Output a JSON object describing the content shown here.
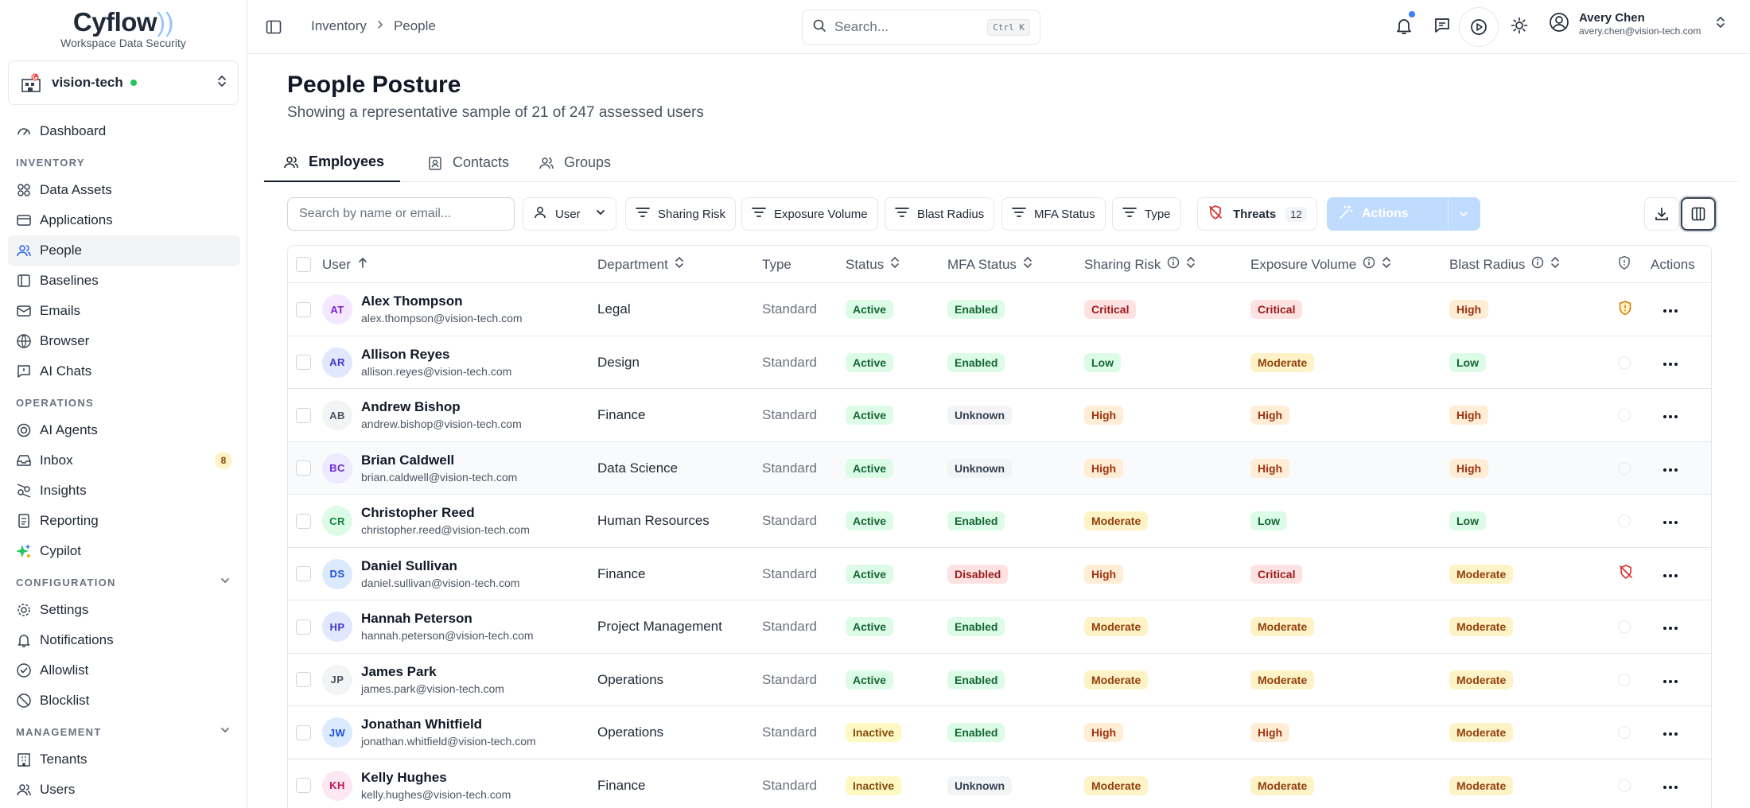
{
  "brand": {
    "name": "Cyflow",
    "tagline": "Workspace Data Security"
  },
  "tenant": {
    "name": "vision-tech",
    "status_color": "#22c55e"
  },
  "sidebar": {
    "top": [
      {
        "label": "Dashboard",
        "icon": "dashboard-icon"
      }
    ],
    "inventory_heading": "INVENTORY",
    "inventory": [
      {
        "label": "Data Assets",
        "icon": "data-assets-icon"
      },
      {
        "label": "Applications",
        "icon": "applications-icon"
      },
      {
        "label": "People",
        "icon": "people-icon",
        "active": true
      },
      {
        "label": "Baselines",
        "icon": "baselines-icon"
      },
      {
        "label": "Emails",
        "icon": "mail-icon"
      },
      {
        "label": "Browser",
        "icon": "globe-icon"
      },
      {
        "label": "AI Chats",
        "icon": "chat-icon"
      }
    ],
    "operations_heading": "OPERATIONS",
    "operations": [
      {
        "label": "AI Agents",
        "icon": "agents-icon"
      },
      {
        "label": "Inbox",
        "icon": "inbox-icon",
        "badge": "8"
      },
      {
        "label": "Insights",
        "icon": "insights-icon"
      },
      {
        "label": "Reporting",
        "icon": "reporting-icon"
      },
      {
        "label": "Cypilot",
        "icon": "sparkle-icon"
      }
    ],
    "configuration_heading": "CONFIGURATION",
    "configuration": [
      {
        "label": "Settings",
        "icon": "gear-icon"
      },
      {
        "label": "Notifications",
        "icon": "bell-icon"
      },
      {
        "label": "Allowlist",
        "icon": "check-circle-icon"
      },
      {
        "label": "Blocklist",
        "icon": "ban-icon"
      }
    ],
    "management_heading": "MANAGEMENT",
    "management": [
      {
        "label": "Tenants",
        "icon": "tenants-icon"
      },
      {
        "label": "Users",
        "icon": "users-icon"
      }
    ]
  },
  "topbar": {
    "breadcrumb": [
      "Inventory",
      "People"
    ],
    "search_placeholder": "Search...",
    "search_shortcut": "Ctrl K",
    "user_name": "Avery Chen",
    "user_email": "avery.chen@vision-tech.com",
    "accent": "#3b82f6"
  },
  "page": {
    "title": "People Posture",
    "subtitle": "Showing a representative sample of 21 of 247 assessed users"
  },
  "tabs": [
    {
      "label": "Employees",
      "active": true
    },
    {
      "label": "Contacts"
    },
    {
      "label": "Groups"
    }
  ],
  "toolbar": {
    "search_placeholder": "Search by name or email...",
    "user_filter": "User",
    "filters": [
      "Sharing Risk",
      "Exposure Volume",
      "Blast Radius",
      "MFA Status",
      "Type"
    ],
    "threats_label": "Threats",
    "threats_count": "12",
    "actions_label": "Actions"
  },
  "table": {
    "columns": [
      "User",
      "Department",
      "Type",
      "Status",
      "MFA Status",
      "Sharing Risk",
      "Exposure Volume",
      "Blast Radius",
      "Actions"
    ],
    "rows": [
      {
        "initials": "AT",
        "name": "Alex Thompson",
        "email": "alex.thompson@vision-tech.com",
        "department": "Legal",
        "type": "Standard",
        "status": "Active",
        "mfa": "Enabled",
        "sharing": "Critical",
        "exposure": "Critical",
        "blast": "High",
        "threat": "shield-warning"
      },
      {
        "initials": "AR",
        "name": "Allison Reyes",
        "email": "allison.reyes@vision-tech.com",
        "department": "Design",
        "type": "Standard",
        "status": "Active",
        "mfa": "Enabled",
        "sharing": "Low",
        "exposure": "Moderate",
        "blast": "Low",
        "threat": "none"
      },
      {
        "initials": "AB",
        "name": "Andrew Bishop",
        "email": "andrew.bishop@vision-tech.com",
        "department": "Finance",
        "type": "Standard",
        "status": "Active",
        "mfa": "Unknown",
        "sharing": "High",
        "exposure": "High",
        "blast": "High",
        "threat": "none"
      },
      {
        "initials": "BC",
        "name": "Brian Caldwell",
        "email": "brian.caldwell@vision-tech.com",
        "department": "Data Science",
        "type": "Standard",
        "status": "Active",
        "mfa": "Unknown",
        "sharing": "High",
        "exposure": "High",
        "blast": "High",
        "threat": "none",
        "highlight": true
      },
      {
        "initials": "CR",
        "name": "Christopher Reed",
        "email": "christopher.reed@vision-tech.com",
        "department": "Human Resources",
        "type": "Standard",
        "status": "Active",
        "mfa": "Enabled",
        "sharing": "Moderate",
        "exposure": "Low",
        "blast": "Low",
        "threat": "none"
      },
      {
        "initials": "DS",
        "name": "Daniel Sullivan",
        "email": "daniel.sullivan@vision-tech.com",
        "department": "Finance",
        "type": "Standard",
        "status": "Active",
        "mfa": "Disabled",
        "sharing": "High",
        "exposure": "Critical",
        "blast": "Moderate",
        "threat": "shield-off"
      },
      {
        "initials": "HP",
        "name": "Hannah Peterson",
        "email": "hannah.peterson@vision-tech.com",
        "department": "Project Management",
        "type": "Standard",
        "status": "Active",
        "mfa": "Enabled",
        "sharing": "Moderate",
        "exposure": "Moderate",
        "blast": "Moderate",
        "threat": "none"
      },
      {
        "initials": "JP",
        "name": "James Park",
        "email": "james.park@vision-tech.com",
        "department": "Operations",
        "type": "Standard",
        "status": "Active",
        "mfa": "Enabled",
        "sharing": "Moderate",
        "exposure": "Moderate",
        "blast": "Moderate",
        "threat": "none"
      },
      {
        "initials": "JW",
        "name": "Jonathan Whitfield",
        "email": "jonathan.whitfield@vision-tech.com",
        "department": "Operations",
        "type": "Standard",
        "status": "Inactive",
        "mfa": "Enabled",
        "sharing": "High",
        "exposure": "High",
        "blast": "Moderate",
        "threat": "none"
      },
      {
        "initials": "KH",
        "name": "Kelly Hughes",
        "email": "kelly.hughes@vision-tech.com",
        "department": "Finance",
        "type": "Standard",
        "status": "Inactive",
        "mfa": "Unknown",
        "sharing": "Moderate",
        "exposure": "Moderate",
        "blast": "Moderate",
        "threat": "none"
      }
    ]
  },
  "colors": {
    "critical": "#fee2e2",
    "high": "#ffedd5",
    "moderate": "#fef3c7",
    "low": "#dcfce7",
    "unknown": "#f3f4f6"
  }
}
